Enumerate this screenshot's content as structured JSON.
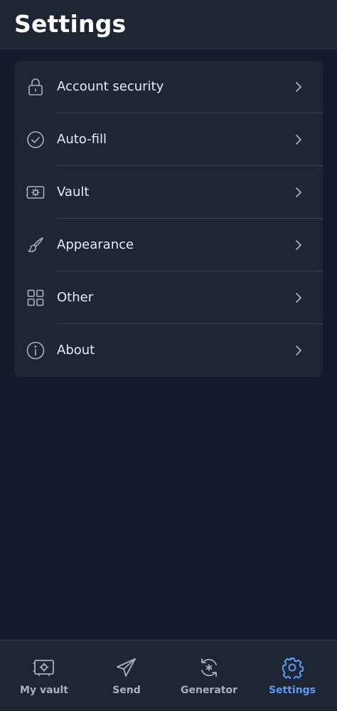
{
  "header": {
    "title": "Settings"
  },
  "settings_list": {
    "items": [
      {
        "label": "Account security",
        "icon": "lock-icon"
      },
      {
        "label": "Auto-fill",
        "icon": "check-circle-icon"
      },
      {
        "label": "Vault",
        "icon": "vault-icon"
      },
      {
        "label": "Appearance",
        "icon": "paintbrush-icon"
      },
      {
        "label": "Other",
        "icon": "grid-icon"
      },
      {
        "label": "About",
        "icon": "info-circle-icon"
      }
    ],
    "chevron_icon": "chevron-right-icon"
  },
  "bottom_nav": {
    "items": [
      {
        "label": "My vault",
        "icon": "vault-icon",
        "active": false
      },
      {
        "label": "Send",
        "icon": "paper-plane-icon",
        "active": false
      },
      {
        "label": "Generator",
        "icon": "generator-refresh-icon",
        "active": false
      },
      {
        "label": "Settings",
        "icon": "gear-icon",
        "active": true
      }
    ]
  },
  "colors": {
    "background": "#141b2b",
    "surface": "#1f2633",
    "accent": "#5b9cf5",
    "icon_muted": "#aab0bc",
    "text": "#e8ebf0"
  }
}
